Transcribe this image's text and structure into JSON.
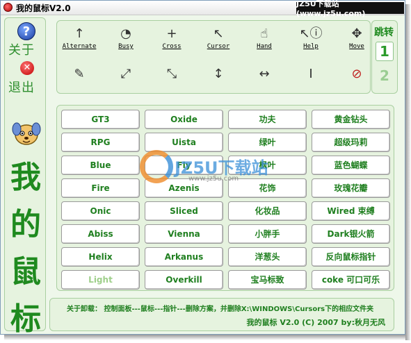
{
  "window": {
    "title": "我的鼠标V2.0",
    "site_badge": "JZ5U下载站(www.jz5u.com)"
  },
  "sidebar": {
    "about_label": "关于",
    "exit_label": "退出",
    "big_title": [
      "我",
      "的",
      "鼠",
      "标"
    ]
  },
  "cursors": {
    "row1": [
      {
        "icon": "arrow-up-cursor-icon",
        "glyph": "↑",
        "label": "Alternate"
      },
      {
        "icon": "busy-cursor-icon",
        "glyph": "◔",
        "label": "Busy"
      },
      {
        "icon": "cross-cursor-icon",
        "glyph": "+",
        "label": "Cross"
      },
      {
        "icon": "pointer-cursor-icon",
        "glyph": "↖",
        "label": "Cursor"
      },
      {
        "icon": "hand-cursor-icon",
        "glyph": "☝",
        "label": "Hand"
      },
      {
        "icon": "help-cursor-icon",
        "glyph": "↖ⓘ",
        "label": "Help"
      },
      {
        "icon": "move-cursor-icon",
        "glyph": "✥",
        "label": "Move"
      }
    ],
    "row2": [
      {
        "icon": "pen-cursor-icon",
        "glyph": "✎"
      },
      {
        "icon": "resize-nesw-cursor-icon",
        "glyph": "⤢"
      },
      {
        "icon": "resize-nwse-cursor-icon",
        "glyph": "⤡"
      },
      {
        "icon": "resize-vertical-cursor-icon",
        "glyph": "↕"
      },
      {
        "icon": "resize-horizontal-cursor-icon",
        "glyph": "↔"
      },
      {
        "icon": "text-beam-cursor-icon",
        "glyph": "I"
      },
      {
        "icon": "unavailable-cursor-icon",
        "glyph": "⊘"
      }
    ]
  },
  "jump": {
    "label": "跳转",
    "page1": "1",
    "page2": "2"
  },
  "schemes": [
    [
      "GT3",
      "Oxide",
      "功夫",
      "黄金钻头"
    ],
    [
      "RPG",
      "Uista",
      "绿叶",
      "超级玛莉"
    ],
    [
      "Blue",
      "Fly",
      "枫叶",
      "蓝色蝴蝶"
    ],
    [
      "Fire",
      "Azenis",
      "花饰",
      "玫瑰花瓣"
    ],
    [
      "Onic",
      "Sliced",
      "化妆品",
      "Wired 束缚"
    ],
    [
      "Abiss",
      "Vienna",
      "小胖手",
      "Dark银火箭"
    ],
    [
      "Helix",
      "Arkanus",
      "洋葱头",
      "反向鼠标指针"
    ],
    [
      "Light",
      "Overkill",
      "宝马标致",
      "coke 可口可乐"
    ]
  ],
  "watermark": {
    "text": "JZ5U下载站",
    "url": "www.jz5u.com"
  },
  "footer": {
    "uninstall": "关于卸载： 控制面板---鼠标---指针---删除方案，并删除X:\\WINDOWS\\Cursors下的相应文件夹",
    "copyright": "我的鼠标 V2.0 (C) 2007 by:秋月无风"
  },
  "colors": {
    "accent_green": "#1f8a1f",
    "panel_bg": "#e6f3df",
    "panel_border": "#a9cfa0"
  }
}
